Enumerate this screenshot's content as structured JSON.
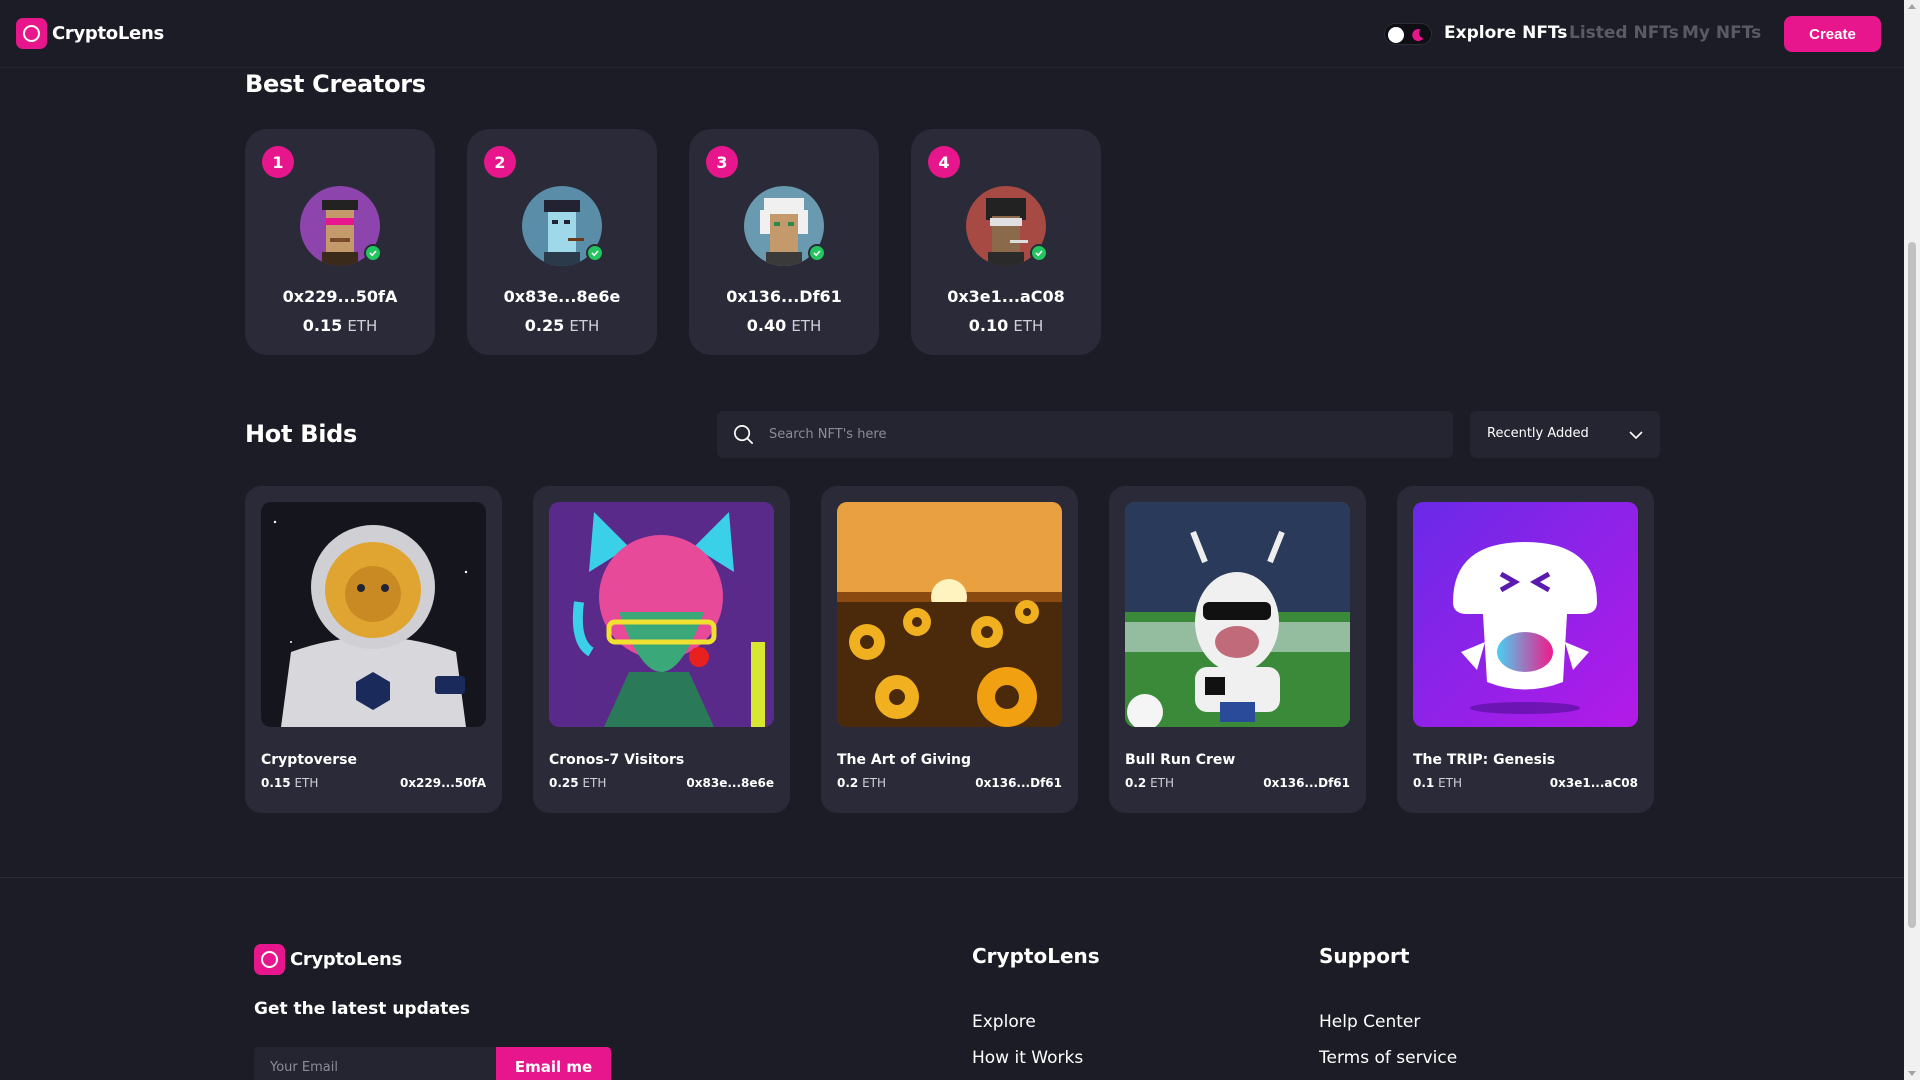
{
  "app": {
    "name": "CryptoLens",
    "accent_color": "#e8168c",
    "background_color": "#1c1c26",
    "card_color": "#2a2a38"
  },
  "header": {
    "logo_text": "CryptoLens",
    "theme_toggle": {
      "state": "dark",
      "icon": "moon-icon"
    },
    "nav": [
      {
        "label": "Explore NFTs",
        "active": true
      },
      {
        "label": "Listed NFTs",
        "active": false
      },
      {
        "label": "My NFTs",
        "active": false
      }
    ],
    "create_label": "Create"
  },
  "best_creators": {
    "title": "Best Creators",
    "items": [
      {
        "rank": "1",
        "name": "0x229...50fA",
        "amount": "0.15",
        "unit": "ETH",
        "verified": true,
        "avatar_bg": "#8e44ad"
      },
      {
        "rank": "2",
        "name": "0x83e...8e6e",
        "amount": "0.25",
        "unit": "ETH",
        "verified": true,
        "avatar_bg": "#5a8ea8"
      },
      {
        "rank": "3",
        "name": "0x136...Df61",
        "amount": "0.40",
        "unit": "ETH",
        "verified": true,
        "avatar_bg": "#6a9ab0"
      },
      {
        "rank": "4",
        "name": "0x3e1...aC08",
        "amount": "0.10",
        "unit": "ETH",
        "verified": true,
        "avatar_bg": "#a84a44"
      }
    ]
  },
  "hot_bids": {
    "title": "Hot Bids",
    "search_placeholder": "Search NFT's here",
    "sort_selected": "Recently Added",
    "items": [
      {
        "name": "Cryptoverse",
        "amount": "0.15",
        "unit": "ETH",
        "owner": "0x229...50fA"
      },
      {
        "name": "Cronos-7 Visitors",
        "amount": "0.25",
        "unit": "ETH",
        "owner": "0x83e...8e6e"
      },
      {
        "name": "The Art of Giving",
        "amount": "0.2",
        "unit": "ETH",
        "owner": "0x136...Df61"
      },
      {
        "name": "Bull Run Crew",
        "amount": "0.2",
        "unit": "ETH",
        "owner": "0x136...Df61"
      },
      {
        "name": "The TRIP: Genesis",
        "amount": "0.1",
        "unit": "ETH",
        "owner": "0x3e1...aC08"
      }
    ]
  },
  "footer": {
    "logo_text": "CryptoLens",
    "updates_label": "Get the latest updates",
    "email_placeholder": "Your Email",
    "email_button": "Email me",
    "columns": [
      {
        "title": "CryptoLens",
        "links": [
          "Explore",
          "How it Works"
        ]
      },
      {
        "title": "Support",
        "links": [
          "Help Center",
          "Terms of service"
        ]
      }
    ]
  }
}
